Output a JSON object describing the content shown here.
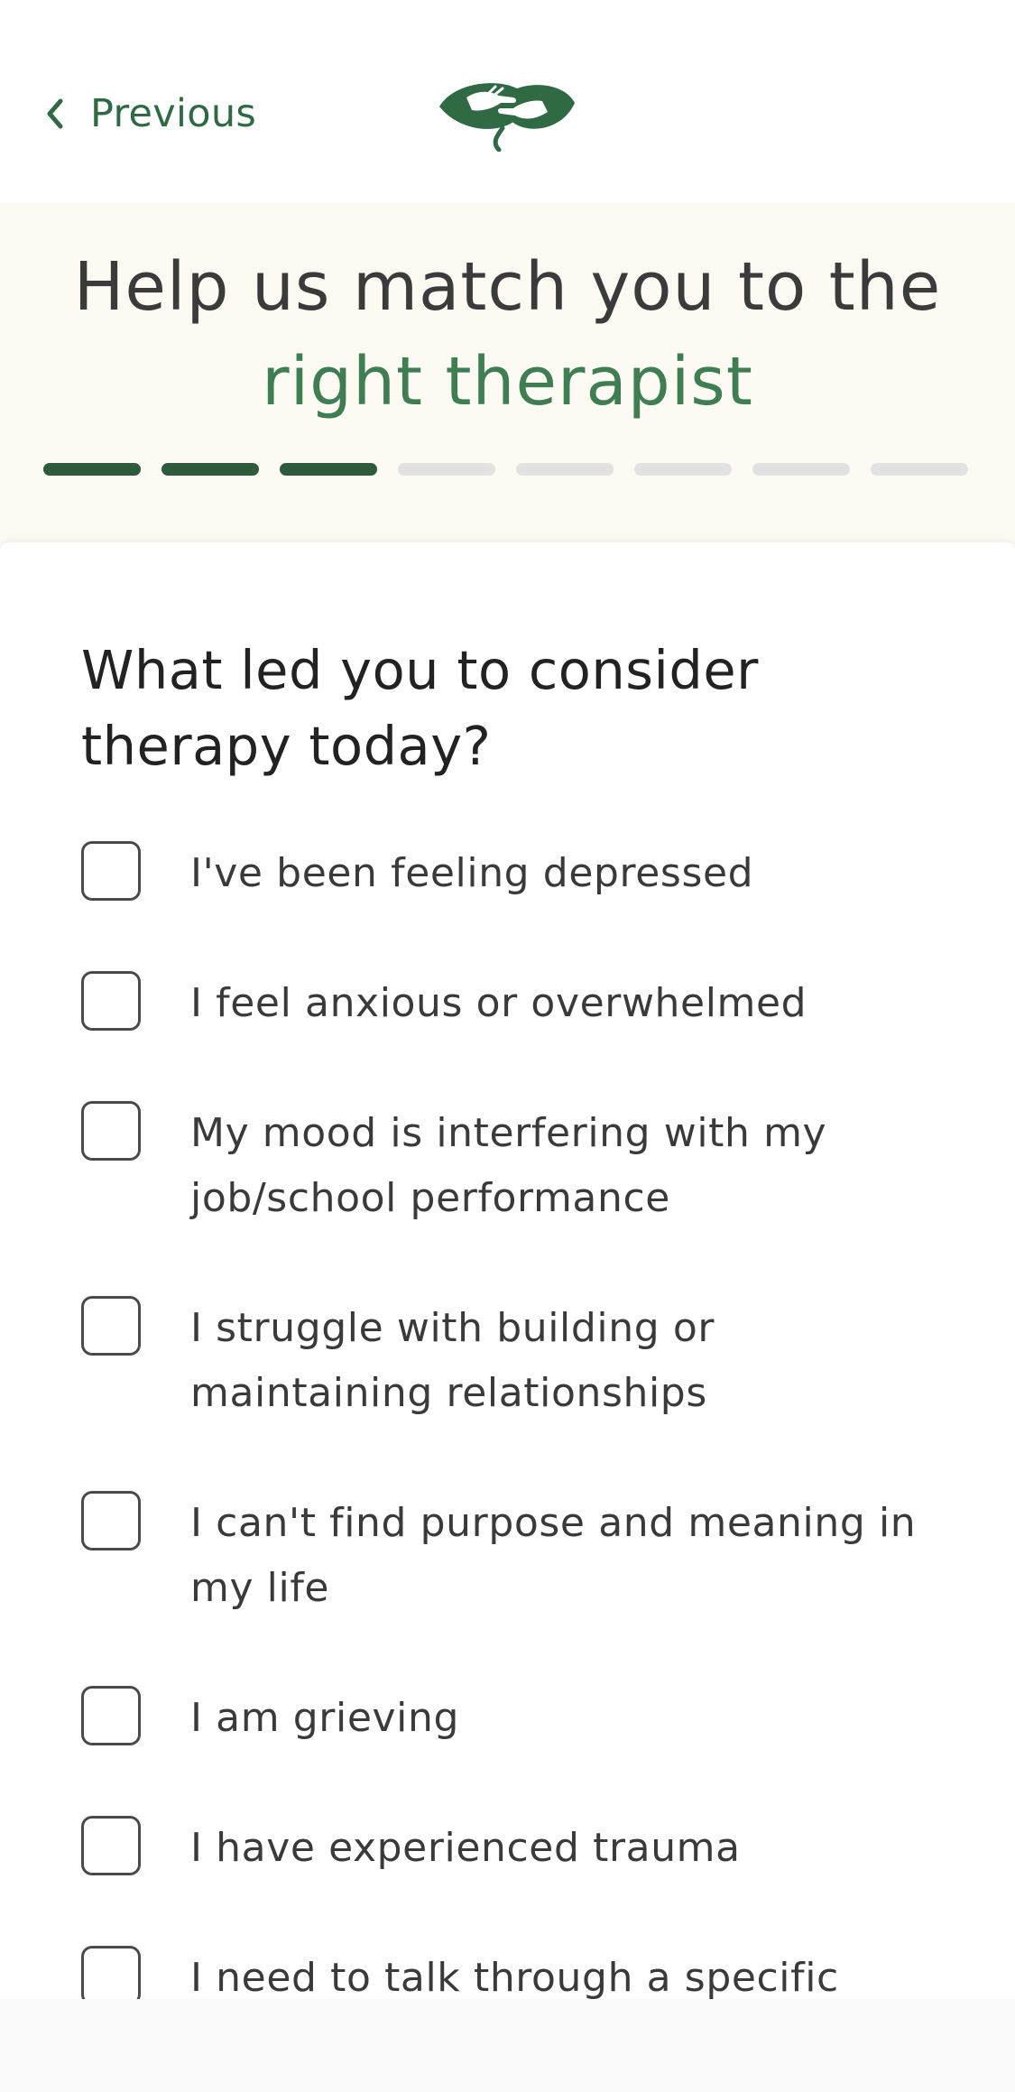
{
  "nav": {
    "previous_label": "Previous"
  },
  "hero": {
    "line1": "Help us match you to the",
    "line2": "right therapist"
  },
  "progress": {
    "completed_steps": 3,
    "total_steps": 8
  },
  "question": {
    "title": "What led you to consider therapy today?"
  },
  "options": [
    {
      "label": "I've been feeling depressed",
      "checked": false
    },
    {
      "label": "I feel anxious or overwhelmed",
      "checked": false
    },
    {
      "label": "My mood is interfering with my job/school performance",
      "checked": false
    },
    {
      "label": "I struggle with building or maintaining relationships",
      "checked": false
    },
    {
      "label": "I can't find purpose and meaning in my life",
      "checked": false
    },
    {
      "label": "I am grieving",
      "checked": false
    },
    {
      "label": "I have experienced trauma",
      "checked": false
    },
    {
      "label": "I need to talk through a specific",
      "checked": false
    }
  ],
  "colors": {
    "brand_green": "#2f6a45",
    "accent_green": "#3f7d53",
    "progress_done": "#2e5a3e",
    "progress_todo": "#e2e2e0",
    "hero_background": "#fdfaf4"
  },
  "icons": {
    "back": "chevron-left-icon",
    "logo": "hands-leaf-logo"
  }
}
